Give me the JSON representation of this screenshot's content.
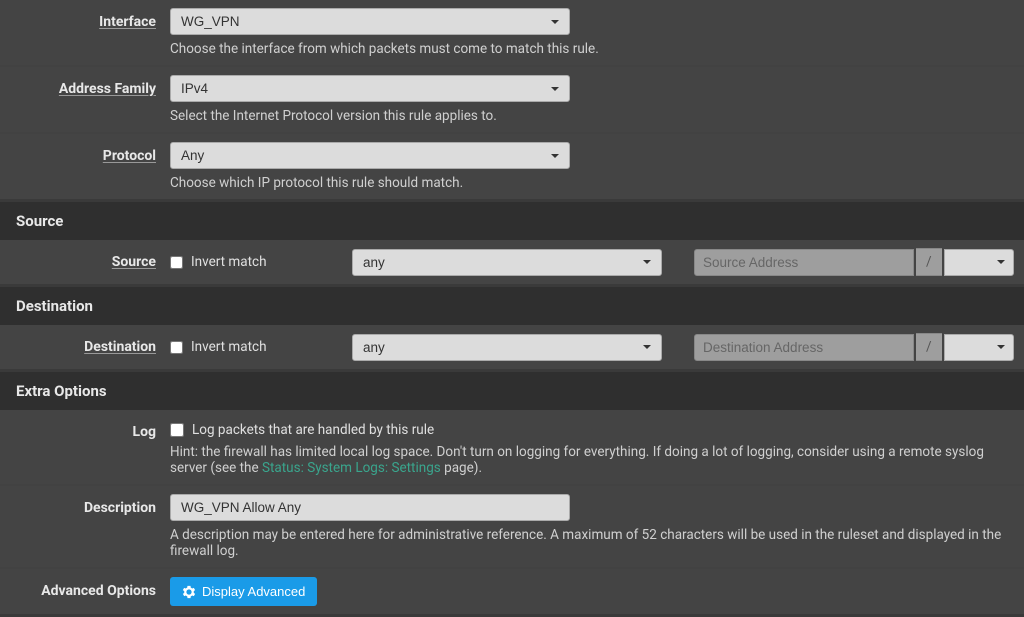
{
  "interface": {
    "label": "Interface",
    "value": "WG_VPN",
    "help": "Choose the interface from which packets must come to match this rule."
  },
  "address_family": {
    "label": "Address Family",
    "value": "IPv4",
    "help": "Select the Internet Protocol version this rule applies to."
  },
  "protocol": {
    "label": "Protocol",
    "value": "Any",
    "help": "Choose which IP protocol this rule should match."
  },
  "source": {
    "section_title": "Source",
    "label": "Source",
    "invert_label": "Invert match",
    "value": "any",
    "addr_placeholder": "Source Address",
    "slash": "/"
  },
  "destination": {
    "section_title": "Destination",
    "label": "Destination",
    "invert_label": "Invert match",
    "value": "any",
    "addr_placeholder": "Destination Address",
    "slash": "/"
  },
  "extra_options": {
    "section_title": "Extra Options"
  },
  "log": {
    "label": "Log",
    "checkbox_label": "Log packets that are handled by this rule",
    "help_prefix": "Hint: the firewall has limited local log space. Don't turn on logging for everything. If doing a lot of logging, consider using a remote syslog server (see the ",
    "help_link": "Status: System Logs: Settings",
    "help_suffix": " page)."
  },
  "description": {
    "label": "Description",
    "value": "WG_VPN Allow Any",
    "help": "A description may be entered here for administrative reference. A maximum of 52 characters will be used in the ruleset and displayed in the firewall log."
  },
  "advanced_options": {
    "label": "Advanced Options",
    "button_label": "Display Advanced"
  }
}
